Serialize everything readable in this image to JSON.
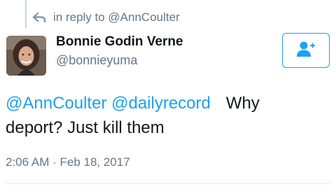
{
  "reply_context": {
    "text": "in reply to @AnnCoulter",
    "icon": "reply-arrow-icon"
  },
  "author": {
    "name": "Bonnie Godin Verne",
    "handle": "@bonnieyuma",
    "avatar_icon": "user-photo-avatar"
  },
  "follow_button": {
    "icon": "add-user-icon",
    "color": "#1da1f2"
  },
  "tweet": {
    "mention_1": "@AnnCoulter",
    "mention_2": "@dailyrecord",
    "text_part_1": "Why",
    "text_part_2": "deport?  Just kill them"
  },
  "timestamp": "2:06 AM · Feb 18, 2017",
  "colors": {
    "link": "#1da1f2",
    "secondary_text": "#657786",
    "primary_text": "#14171a"
  }
}
